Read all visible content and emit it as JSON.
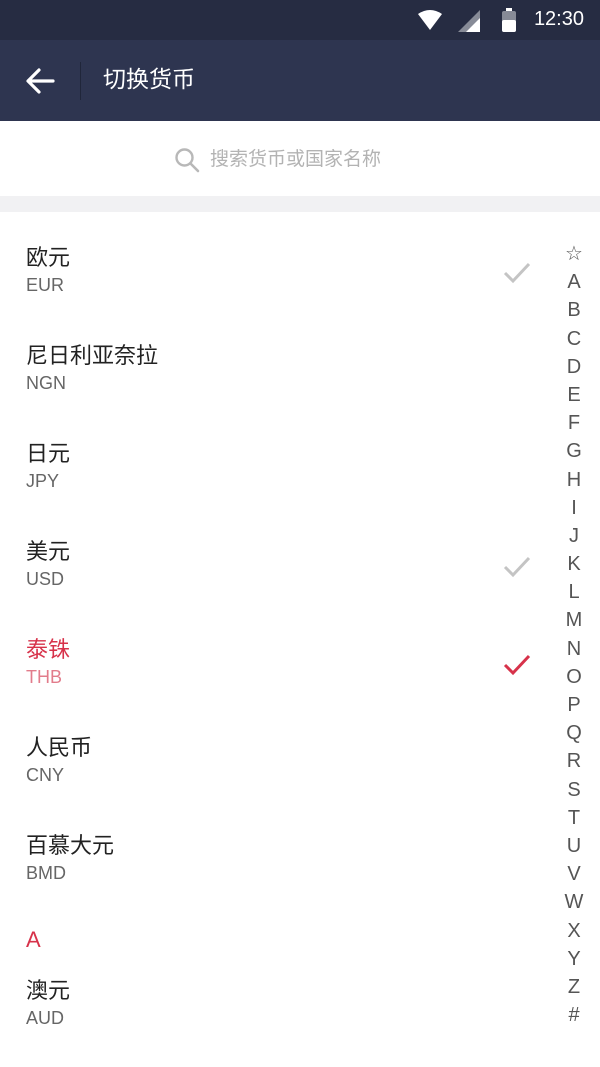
{
  "status_bar": {
    "time": "12:30"
  },
  "app_bar": {
    "title": "切换货币"
  },
  "search": {
    "placeholder": "搜索货币或国家名称"
  },
  "currencies": [
    {
      "name": "欧元",
      "code": "EUR",
      "checked": true,
      "selected": false
    },
    {
      "name": "尼日利亚奈拉",
      "code": "NGN",
      "checked": false,
      "selected": false
    },
    {
      "name": "日元",
      "code": "JPY",
      "checked": false,
      "selected": false
    },
    {
      "name": "美元",
      "code": "USD",
      "checked": true,
      "selected": false
    },
    {
      "name": "泰铢",
      "code": "THB",
      "checked": true,
      "selected": true
    },
    {
      "name": "人民币",
      "code": "CNY",
      "checked": false,
      "selected": false
    },
    {
      "name": "百慕大元",
      "code": "BMD",
      "checked": false,
      "selected": false
    }
  ],
  "section_a": {
    "header": "A",
    "items": [
      {
        "name": "澳元",
        "code": "AUD"
      }
    ]
  },
  "alphabet_index": [
    "☆",
    "A",
    "B",
    "C",
    "D",
    "E",
    "F",
    "G",
    "H",
    "I",
    "J",
    "K",
    "L",
    "M",
    "N",
    "O",
    "P",
    "Q",
    "R",
    "S",
    "T",
    "U",
    "V",
    "W",
    "X",
    "Y",
    "Z",
    "#"
  ],
  "colors": {
    "header_bg": "#2e3550",
    "status_bg": "#262c42",
    "accent": "#d7324a",
    "check_gray": "#c4c4c4"
  }
}
